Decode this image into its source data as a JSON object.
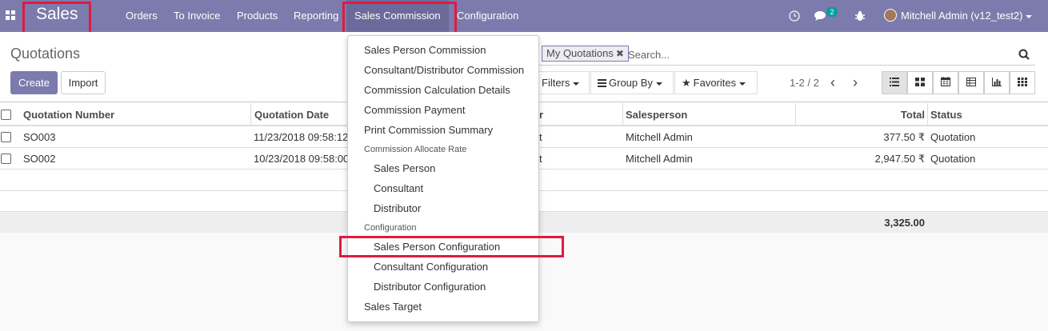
{
  "navbar": {
    "app_name": "Sales",
    "menus": [
      "Orders",
      "To Invoice",
      "Products",
      "Reporting",
      "Sales Commission",
      "Configuration"
    ],
    "active_menu": "Sales Commission",
    "message_count": "2",
    "user": "Mitchell Admin (v12_test2)",
    "brand_color": "#7c7bad",
    "highlight_color": "#e01a3f"
  },
  "control_panel": {
    "breadcrumb": "Quotations",
    "create_label": "Create",
    "import_label": "Import",
    "facet": "My Quotations",
    "facet_remove": "✖",
    "search_placeholder": "Search...",
    "filters_label": "Filters",
    "group_by_label": "Group By",
    "favorites_label": "Favorites",
    "pager": "1-2 / 2",
    "pager_prev": "‹",
    "pager_next": "›"
  },
  "table": {
    "headers": {
      "number": "Quotation Number",
      "date": "Quotation Date",
      "customer": "r",
      "salesperson": "Salesperson",
      "total": "Total",
      "status": "Status"
    },
    "rows": [
      {
        "number": "SO003",
        "date": "11/23/2018 09:58:12",
        "customer": "t",
        "salesperson": "Mitchell Admin",
        "total": "377.50 ₹",
        "status": "Quotation"
      },
      {
        "number": "SO002",
        "date": "10/23/2018 09:58:00",
        "customer": "t",
        "salesperson": "Mitchell Admin",
        "total": "2,947.50 ₹",
        "status": "Quotation"
      }
    ],
    "grand_total": "3,325.00"
  },
  "dropdown": {
    "sales_person_commission": "Sales Person Commission",
    "consultant_distributor_commission": "Consultant/Distributor Commission",
    "commission_calculation_details": "Commission Calculation Details",
    "commission_payment": "Commission Payment",
    "print_commission_summary": "Print Commission Summary",
    "allocate_header": "Commission Allocate Rate",
    "rate_sales_person": "Sales Person",
    "rate_consultant": "Consultant",
    "rate_distributor": "Distributor",
    "config_header": "Configuration",
    "sales_person_configuration": "Sales Person Configuration",
    "consultant_configuration": "Consultant Configuration",
    "distributor_configuration": "Distributor Configuration",
    "sales_target": "Sales Target"
  }
}
